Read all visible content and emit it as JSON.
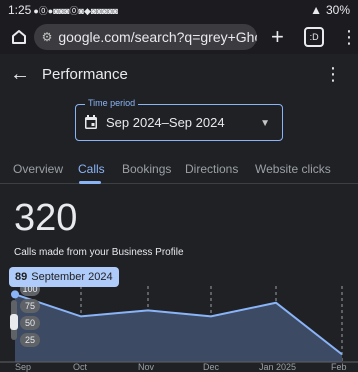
{
  "status_bar": {
    "time": "1:25",
    "icons": "●⓪●◙◙◙⓪◙◆◙◙◙◙◙",
    "right_extra": "1↑ ⁂ ▫",
    "battery": "30%"
  },
  "browser": {
    "url": "google.com/search?q=grey+Ghost+--",
    "tab_count": ":D"
  },
  "app": {
    "title": "Performance"
  },
  "period": {
    "label": "Time period",
    "value": "Sep 2024–Sep 2024"
  },
  "tabs": [
    {
      "label": "Overview"
    },
    {
      "label": "Calls"
    },
    {
      "label": "Bookings"
    },
    {
      "label": "Directions"
    },
    {
      "label": "Website clicks"
    }
  ],
  "active_tab": "Calls",
  "summary": {
    "total": "320",
    "caption": "Calls made from your Business Profile"
  },
  "tooltip": {
    "value": "89",
    "date": "September 2024"
  },
  "chart_data": {
    "type": "area",
    "x": [
      "Sep",
      "Oct",
      "Nov",
      "Dec",
      "Jan 2025",
      "Feb"
    ],
    "values": [
      89,
      60,
      68,
      60,
      78,
      10
    ],
    "yticks": [
      "100",
      "75",
      "50",
      "25"
    ],
    "ylim": [
      0,
      100
    ],
    "grid": "vertical-dashed",
    "colors": {
      "line": "#8ab4f8",
      "fill": "#3d4a63"
    }
  }
}
